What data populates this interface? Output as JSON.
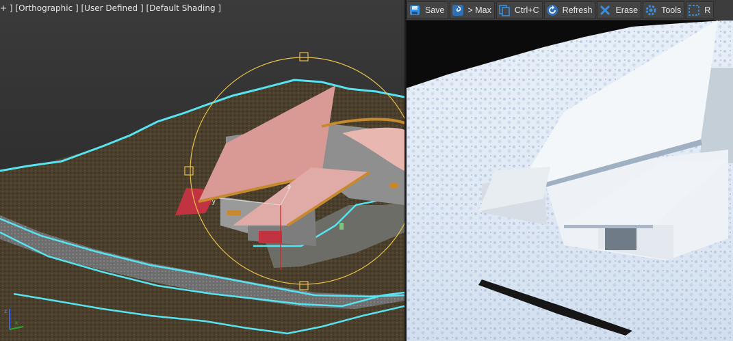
{
  "viewport": {
    "label_parts": [
      "+ ]",
      "[Orthographic ]",
      "[User Defined ]",
      "[Default Shading ]"
    ],
    "gizmo_axis_labels": {
      "x": "x",
      "y": "y",
      "z": "z"
    },
    "colors": {
      "terrain": "#4a3f2e",
      "spline": "#58e3f0",
      "roof": "#d99a96",
      "gizmo": "#e8c04a"
    }
  },
  "render_toolbar": {
    "buttons": [
      {
        "name": "save-button",
        "icon": "floppy-disk-icon",
        "label": "Save"
      },
      {
        "name": "send-to-max-button",
        "icon": "swirl-icon",
        "label": "> Max"
      },
      {
        "name": "copy-button",
        "icon": "copy-icon",
        "label": "Ctrl+C"
      },
      {
        "name": "refresh-button",
        "icon": "refresh-icon",
        "label": "Refresh"
      },
      {
        "name": "erase-button",
        "icon": "erase-x-icon",
        "label": "Erase"
      },
      {
        "name": "tools-button",
        "icon": "gear-icon",
        "label": "Tools"
      },
      {
        "name": "region-button",
        "icon": "region-select-icon",
        "label": "R"
      }
    ],
    "accent": "#3a8fe0"
  }
}
